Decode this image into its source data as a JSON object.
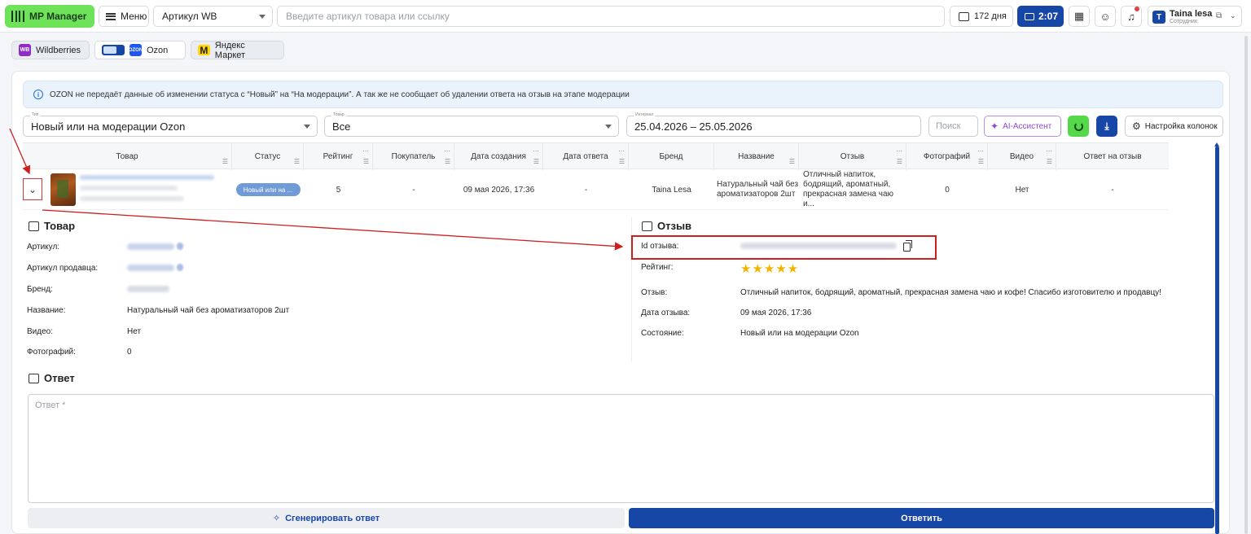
{
  "topbar": {
    "logo_label": "MP Manager",
    "menu_label": "Меню",
    "article_select": "Артикул WB",
    "search_placeholder": "Введите артикул товара или ссылку",
    "days_label": "172 дня",
    "timer_label": "2:07",
    "user": {
      "initial": "T",
      "name": "Taina lesa",
      "role": "Сотрудник"
    }
  },
  "marketplaces": {
    "wb_logo": "WB",
    "wb_label": "Wildberries",
    "ozon_logo": "OZON",
    "ozon_label": "Ozon",
    "ym_logo": "M",
    "ym_label": "Яндекс Маркет"
  },
  "info_banner": "OZON не передаёт данные об изменении статуса с “Новый” на “На модерации”. А так же не сообщает об удалении ответа на отзыв на этапе модерации",
  "filters": {
    "type_label": "Тип",
    "type_value": "Новый или на модерации Ozon",
    "product_label": "Товар",
    "product_value": "Все",
    "interval_label": "Интервал",
    "interval_value": "25.04.2026 – 25.05.2026",
    "search_placeholder": "Поиск",
    "ai_label": "AI-Ассистент",
    "columns_label": "Настройка колонок"
  },
  "table": {
    "headers": {
      "product": "Товар",
      "status": "Статус",
      "rating": "Рейтинг",
      "buyer": "Покупатель",
      "created": "Дата создания",
      "answered": "Дата ответа",
      "brand": "Бренд",
      "name": "Название",
      "review": "Отзыв",
      "photos": "Фотографий",
      "video": "Видео",
      "reply": "Ответ на отзыв"
    },
    "row": {
      "status": "Новый или на ...",
      "rating": "5",
      "buyer": "-",
      "created": "09 мая 2026, 17:36",
      "answered": "-",
      "brand": "Taina Lesa",
      "name": "Натуральный чай без ароматизаторов 2шт",
      "review": "Отличный напиток, бодрящий, ароматный, прекрасная замена чаю и...",
      "photos": "0",
      "video": "Нет",
      "reply": "-"
    }
  },
  "product_panel": {
    "title": "Товар",
    "article_key": "Артикул:",
    "seller_article_key": "Артикул продавца:",
    "brand_key": "Бренд:",
    "name_key": "Название:",
    "name_value": "Натуральный чай без ароматизаторов 2шт",
    "video_key": "Видео:",
    "video_value": "Нет",
    "photos_key": "Фотографий:",
    "photos_value": "0"
  },
  "review_panel": {
    "title": "Отзыв",
    "id_key": "Id отзыва:",
    "rating_key": "Рейтинг:",
    "rating_value": 5,
    "stars": "★★★★★",
    "review_key": "Отзыв:",
    "review_value": "Отличный напиток, бодрящий, ароматный, прекрасная замена чаю и кофе! Спасибо изготовителю и продавцу!",
    "date_key": "Дата отзыва:",
    "date_value": "09 мая 2026, 17:36",
    "state_key": "Состояние:",
    "state_value": "Новый или на модерации Ozon"
  },
  "answer": {
    "title": "Ответ",
    "placeholder": "Ответ *",
    "generate_label": "Сгенерировать ответ",
    "reply_label": "Ответить"
  },
  "colors": {
    "accent": "#1747a6",
    "brand_green": "#6ee35a",
    "annotation": "#cc1f1f",
    "star": "#f3b400"
  },
  "icons": [
    "logo-icon",
    "hamburger-icon",
    "chat-icon",
    "camera-icon",
    "calendar-icon",
    "smile-icon",
    "bell-icon",
    "copy-icon",
    "chevron-down-icon",
    "info-icon",
    "sparkle-icon",
    "refresh-icon",
    "download-icon",
    "gear-icon",
    "box-icon",
    "comment-icon",
    "star-icon"
  ]
}
